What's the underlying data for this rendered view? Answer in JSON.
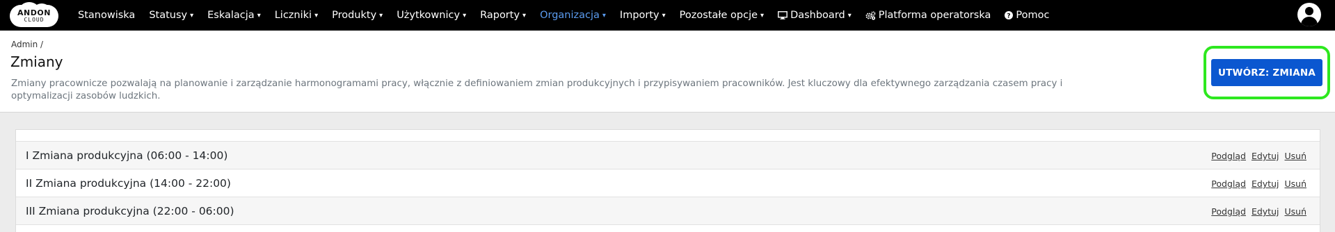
{
  "navbar": {
    "logo_text_top": "ANDON",
    "logo_text_bottom": "CLOUD",
    "items": [
      {
        "label": "Stanowiska",
        "caret": ""
      },
      {
        "label": "Statusy",
        "caret": "▾"
      },
      {
        "label": "Eskalacja",
        "caret": "▾"
      },
      {
        "label": "Liczniki",
        "caret": "▾"
      },
      {
        "label": "Produkty",
        "caret": "▾"
      },
      {
        "label": "Użytkownicy",
        "caret": "▾"
      },
      {
        "label": "Raporty",
        "caret": "▾"
      },
      {
        "label": "Organizacja",
        "caret": "▾",
        "active": true
      },
      {
        "label": "Importy",
        "caret": "▾"
      },
      {
        "label": "Pozostałe opcje",
        "caret": "▾"
      },
      {
        "label": "Dashboard",
        "caret": "▾",
        "icon": "monitor-icon"
      },
      {
        "label": "Platforma operatorska",
        "caret": "",
        "icon": "gears-icon"
      },
      {
        "label": "Pomoc",
        "caret": "",
        "icon": "question-circle-icon"
      }
    ],
    "user_icon": "user-circle-icon",
    "active_color": "#5b9cf0"
  },
  "header": {
    "breadcrumb": "Admin /",
    "title": "Zmiany",
    "description": "Zmiany pracownicze pozwalają na planowanie i zarządzanie harmonogramami pracy, włącznie z definiowaniem zmian produkcyjnych i przypisywaniem pracowników. Jest kluczowy dla efektywnego zarządzania czasem pracy i optymalizacji zasobów ludzkich.",
    "create_button": "UTWÓRZ: ZMIANA",
    "button_color": "#0b57d0",
    "highlight_color": "#2ee81f"
  },
  "list": {
    "rows": [
      {
        "name": "I Zmiana produkcyjna (06:00 - 14:00)"
      },
      {
        "name": "II Zmiana produkcyjna (14:00 - 22:00)"
      },
      {
        "name": "III Zmiana produkcyjna (22:00 - 06:00)"
      }
    ],
    "actions": {
      "view": "Podgląd",
      "edit": "Edytuj",
      "delete": "Usuń"
    }
  }
}
